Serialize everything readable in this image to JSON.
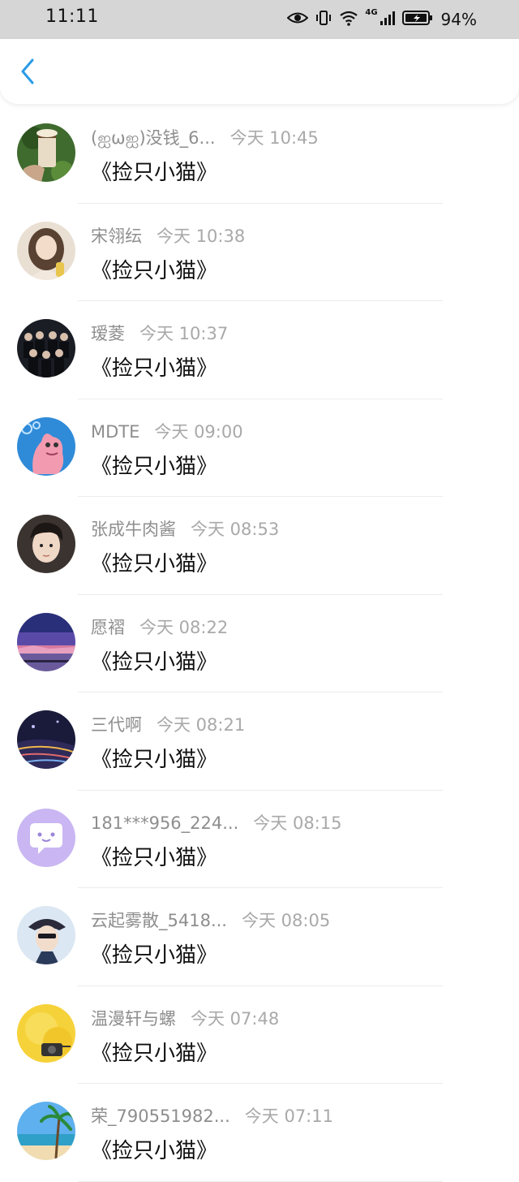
{
  "status_bar": {
    "time": "11:11",
    "network": "4G",
    "battery": "94%",
    "icons": [
      "eye-icon",
      "vibrate-icon",
      "wifi-icon",
      "signal-icon",
      "battery-icon"
    ]
  },
  "header": {
    "back_icon": "chevron-left-icon",
    "accent_color": "#2a9be8"
  },
  "messages": [
    {
      "name": "(ஐωஐ)没钱_6...",
      "time": "今天 10:45",
      "content": "《捡只小猫》",
      "avatar": "avatar-coffee-cup"
    },
    {
      "name": "宋翎纭",
      "time": "今天 10:38",
      "content": "《捡只小猫》",
      "avatar": "avatar-girl"
    },
    {
      "name": "瑷菱",
      "time": "今天 10:37",
      "content": "《捡只小猫》",
      "avatar": "avatar-group-photo"
    },
    {
      "name": "MDTE",
      "time": "今天 09:00",
      "content": "《捡只小猫》",
      "avatar": "avatar-pink-starfish"
    },
    {
      "name": "张成牛肉酱",
      "time": "今天 08:53",
      "content": "《捡只小猫》",
      "avatar": "avatar-young-man"
    },
    {
      "name": "愿褶",
      "time": "今天 08:22",
      "content": "《捡只小猫》",
      "avatar": "avatar-sunset-sky"
    },
    {
      "name": "三代啊",
      "time": "今天 08:21",
      "content": "《捡只小猫》",
      "avatar": "avatar-night-city"
    },
    {
      "name": "181***956_224...",
      "time": "今天 08:15",
      "content": "《捡只小猫》",
      "avatar": "avatar-default-chat"
    },
    {
      "name": "云起雾散_5418...",
      "time": "今天 08:05",
      "content": "《捡只小猫》",
      "avatar": "avatar-girl-with-hat"
    },
    {
      "name": "温漫轩与螺",
      "time": "今天 07:48",
      "content": "《捡只小猫》",
      "avatar": "avatar-yellow-camera"
    },
    {
      "name": "荣_790551982...",
      "time": "今天 07:11",
      "content": "《捡只小猫》",
      "avatar": "avatar-beach-palm"
    }
  ]
}
